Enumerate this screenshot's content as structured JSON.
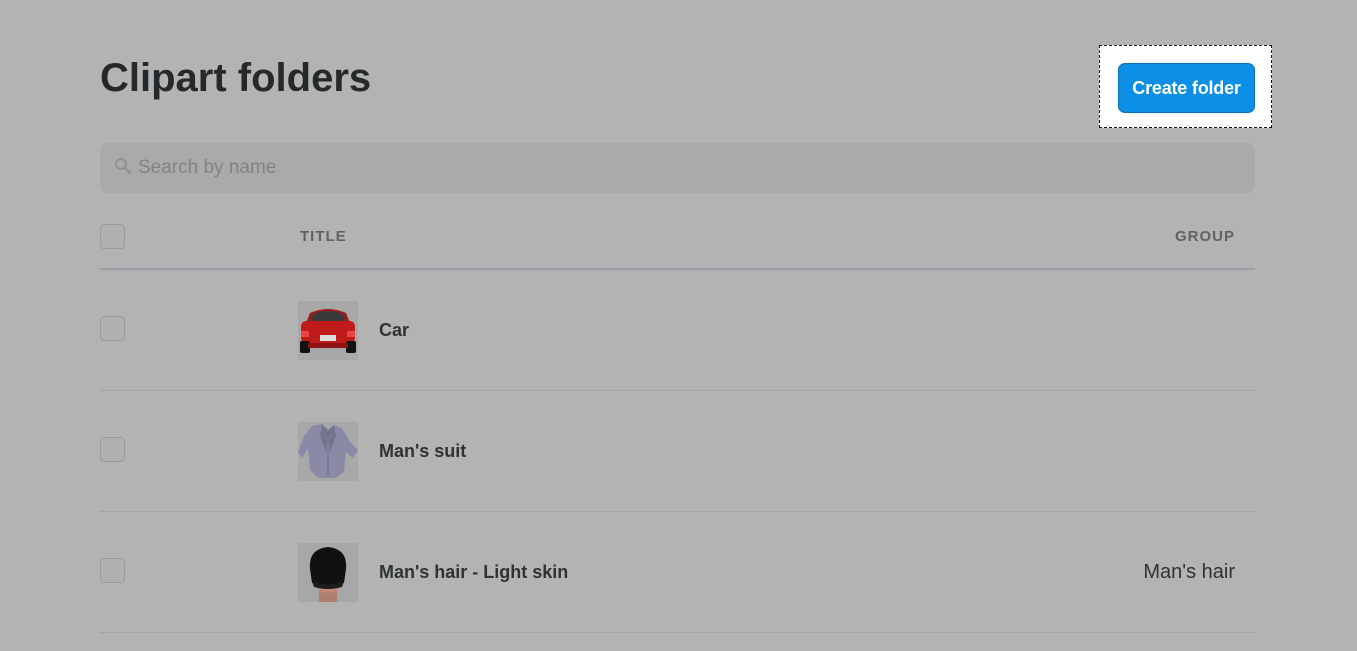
{
  "header": {
    "title": "Clipart folders",
    "create_button_label": "Create folder"
  },
  "search": {
    "placeholder": "Search by name",
    "value": ""
  },
  "table": {
    "columns": [
      "TITLE",
      "GROUP"
    ],
    "rows": [
      {
        "title": "Car",
        "group": "",
        "thumbnail": "car-image"
      },
      {
        "title": "Man's suit",
        "group": "",
        "thumbnail": "suit-image"
      },
      {
        "title": "Man's hair - Light skin",
        "group": "Man's hair",
        "thumbnail": "hair-image"
      }
    ]
  },
  "colors": {
    "overlay_bg": "#b3b3b3",
    "accent": "#0a8ee6"
  }
}
